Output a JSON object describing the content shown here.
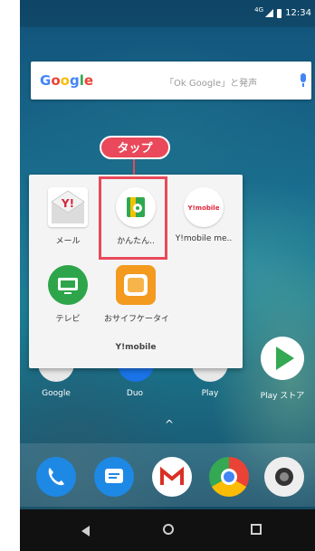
{
  "status": {
    "time": "12:34",
    "network": "4G"
  },
  "search": {
    "logo": "Google",
    "hint": "「Ok Google」と発声"
  },
  "callout": {
    "label": "タップ"
  },
  "folder": {
    "name": "Y!mobile",
    "apps": [
      {
        "label": "メール",
        "icon": "ymail-icon"
      },
      {
        "label": "かんたん..",
        "icon": "kantan-settings-icon"
      },
      {
        "label": "Y!mobile me..",
        "icon": "ymobile-menu-icon"
      },
      {
        "label": "テレビ",
        "icon": "tv-icon"
      },
      {
        "label": "おサイフケータイ",
        "icon": "osaifu-icon"
      }
    ]
  },
  "home_row": [
    {
      "label": "Google"
    },
    {
      "label": "Duo"
    },
    {
      "label": "Play"
    },
    {
      "label": "Play ストア"
    }
  ],
  "dock": [
    {
      "icon": "phone-icon"
    },
    {
      "icon": "messages-icon"
    },
    {
      "icon": "gmail-icon"
    },
    {
      "icon": "chrome-icon"
    },
    {
      "icon": "camera-icon"
    }
  ],
  "colors": {
    "accent": "#e9495a",
    "play_green": "#34a853"
  }
}
